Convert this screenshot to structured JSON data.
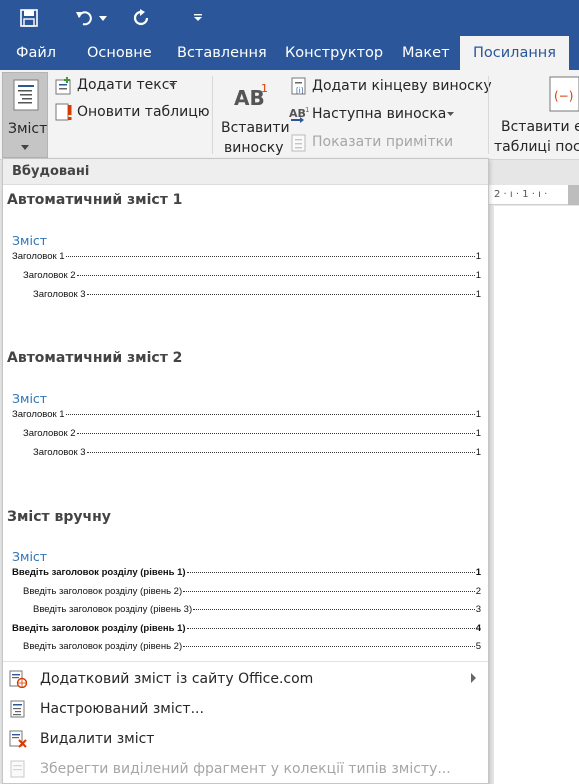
{
  "tabs": [
    {
      "label": "Файл"
    },
    {
      "label": "Основне"
    },
    {
      "label": "Вставлення"
    },
    {
      "label": "Конструктор"
    },
    {
      "label": "Макет"
    },
    {
      "label": "Посилання"
    }
  ],
  "ribbon": {
    "toc_button_label": "Зміст",
    "add_text_label": "Додати текст",
    "update_table_label": "Оновити таблицю",
    "insert_footnote_line1": "Вставити",
    "insert_footnote_line2": "виноску",
    "insert_endnote_label": "Додати кінцеву виноску",
    "next_footnote_label": "Наступна виноска",
    "show_notes_label": "Показати примітки",
    "insert_citation_line1": "Вставити ел",
    "insert_citation_line2": "таблиці пос"
  },
  "ruler_text": "2 · ı · 1 · ı ·",
  "dropdown": {
    "header": "Вбудовані",
    "sections": [
      {
        "title": "Автоматичний зміст 1",
        "toc_heading": "Зміст",
        "lines": [
          {
            "text": "Заголовок 1",
            "page": "1"
          },
          {
            "text": "Заголовок 2",
            "page": "1"
          },
          {
            "text": "Заголовок 3",
            "page": "1"
          }
        ]
      },
      {
        "title": "Автоматичний зміст 2",
        "toc_heading": "Зміст",
        "lines": [
          {
            "text": "Заголовок 1",
            "page": "1"
          },
          {
            "text": "Заголовок 2",
            "page": "1"
          },
          {
            "text": "Заголовок 3",
            "page": "1"
          }
        ]
      },
      {
        "title": "Зміст вручну",
        "toc_heading": "Зміст",
        "lines": [
          {
            "text": "Введіть заголовок розділу (рівень 1)",
            "page": "1"
          },
          {
            "text": "Введіть заголовок розділу (рівень 2)",
            "page": "2"
          },
          {
            "text": "Введіть заголовок розділу (рівень 3)",
            "page": "3"
          },
          {
            "text": "Введіть заголовок розділу (рівень 1)",
            "page": "4"
          },
          {
            "text": "Введіть заголовок розділу (рівень 2)",
            "page": "5"
          }
        ]
      }
    ],
    "menu": [
      {
        "label": "Додатковий зміст із сайту Office.com"
      },
      {
        "label": "Настроюваний зміст..."
      },
      {
        "label": "Видалити зміст"
      },
      {
        "label": "Зберегти виділений фрагмент у колекції типів змісту..."
      }
    ]
  }
}
